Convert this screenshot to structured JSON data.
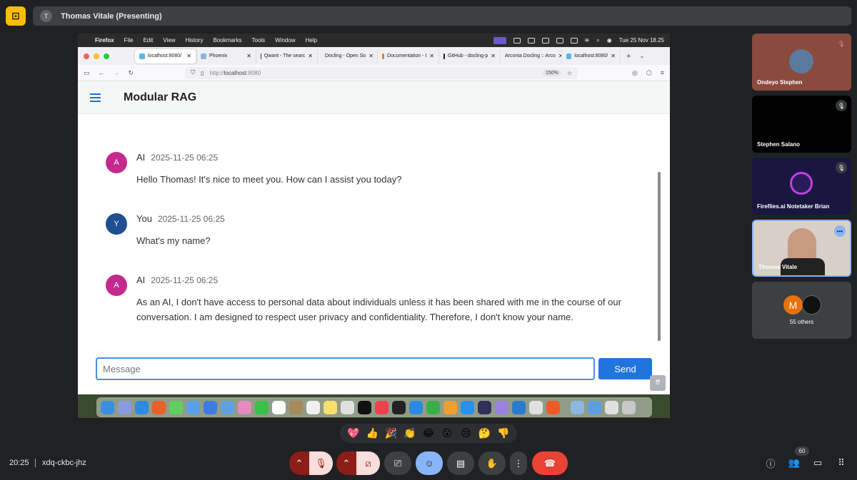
{
  "meet": {
    "presenter_avatar": "T",
    "presenting_label": "Thomas Vitale (Presenting)",
    "clock": "20:25",
    "meeting_code": "xdq-ckbc-jhz",
    "participants_count": "60",
    "reactions": [
      "💖",
      "👍",
      "🎉",
      "👏",
      "😂",
      "😮",
      "😢",
      "🤔",
      "👎"
    ]
  },
  "tiles": [
    {
      "name": "Ondeyo Stephen",
      "muted": true
    },
    {
      "name": "Stephen Salano",
      "muted": true
    },
    {
      "name": "Fireflies.ai Notetaker Brian",
      "muted": true
    },
    {
      "name": "Thomas Vitale",
      "muted": false
    },
    {
      "name": "55 others",
      "avatar_letter": "M"
    }
  ],
  "mac": {
    "app": "Firefox",
    "menus": [
      "File",
      "Edit",
      "View",
      "History",
      "Bookmarks",
      "Tools",
      "Window",
      "Help"
    ],
    "datetime": "Tue 25 Nov 18.25"
  },
  "browser": {
    "tabs": [
      "localhost:8080/",
      "Phoenix",
      "Qwant - The searc",
      "Docling - Open So",
      "Documentation - I",
      "GitHub - docling-p",
      "Arconia Docling :: Arco",
      "localhost:8080/"
    ],
    "url_prefix": "http://",
    "url_host": "localhost",
    "url_rest": ":8080",
    "zoom": "150%"
  },
  "app": {
    "title": "Modular RAG",
    "messages": [
      {
        "avatar": "A",
        "author": "AI",
        "timestamp": "2025-11-25 06:25",
        "text": "Hello Thomas! It's nice to meet you. How can I assist you today?",
        "color": "#c42a8e"
      },
      {
        "avatar": "Y",
        "author": "You",
        "timestamp": "2025-11-25 06:25",
        "text": "What's my name?",
        "color": "#1d4f91"
      },
      {
        "avatar": "A",
        "author": "AI",
        "timestamp": "2025-11-25 06:25",
        "text": "As an AI, I don't have access to personal data about individuals unless it has been shared with me in the course of our conversation. I am designed to respect user privacy and confidentiality. Therefore, I don't know your name.",
        "color": "#c42a8e"
      }
    ],
    "input_placeholder": "Message",
    "send_label": "Send"
  }
}
